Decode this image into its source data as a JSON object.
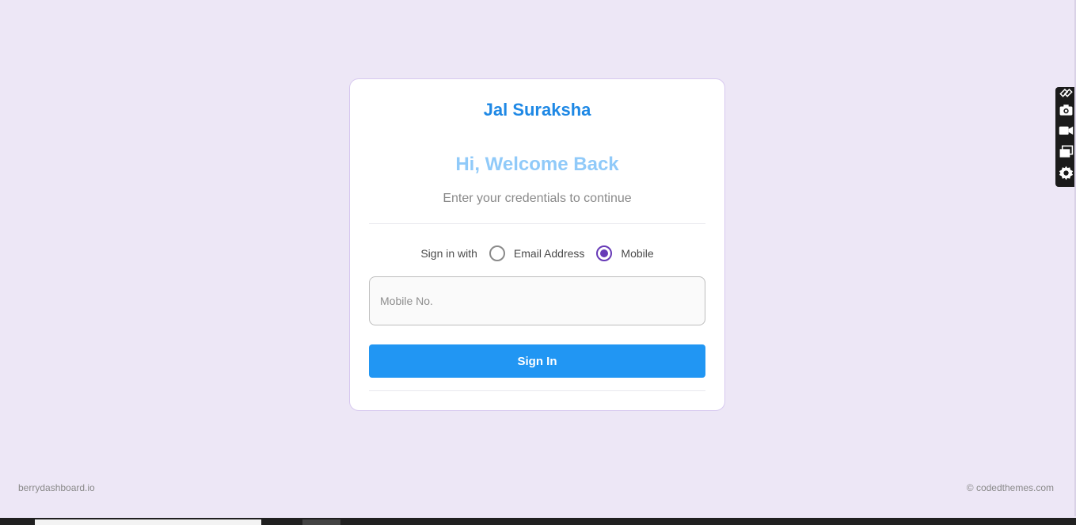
{
  "card": {
    "brand": "Jal Suraksha",
    "welcome": "Hi, Welcome Back",
    "subtitle": "Enter your credentials to continue",
    "signin_with_label": "Sign in with",
    "options": [
      {
        "label": "Email Address",
        "checked": false
      },
      {
        "label": "Mobile",
        "checked": true
      }
    ],
    "mobile_input": {
      "placeholder": "Mobile No.",
      "value": ""
    },
    "signin_button": "Sign In"
  },
  "footer": {
    "left": "berrydashboard.io",
    "right": "© codedthemes.com"
  },
  "tool_panel": {
    "icons": [
      "link-icon",
      "more-icon",
      "camera-icon",
      "video-icon",
      "windows-icon",
      "gear-icon"
    ]
  },
  "colors": {
    "background": "#ede7f6",
    "brand": "#1e88e5",
    "welcome": "#90caf9",
    "button": "#2196f3",
    "radio_checked": "#673ab7"
  }
}
